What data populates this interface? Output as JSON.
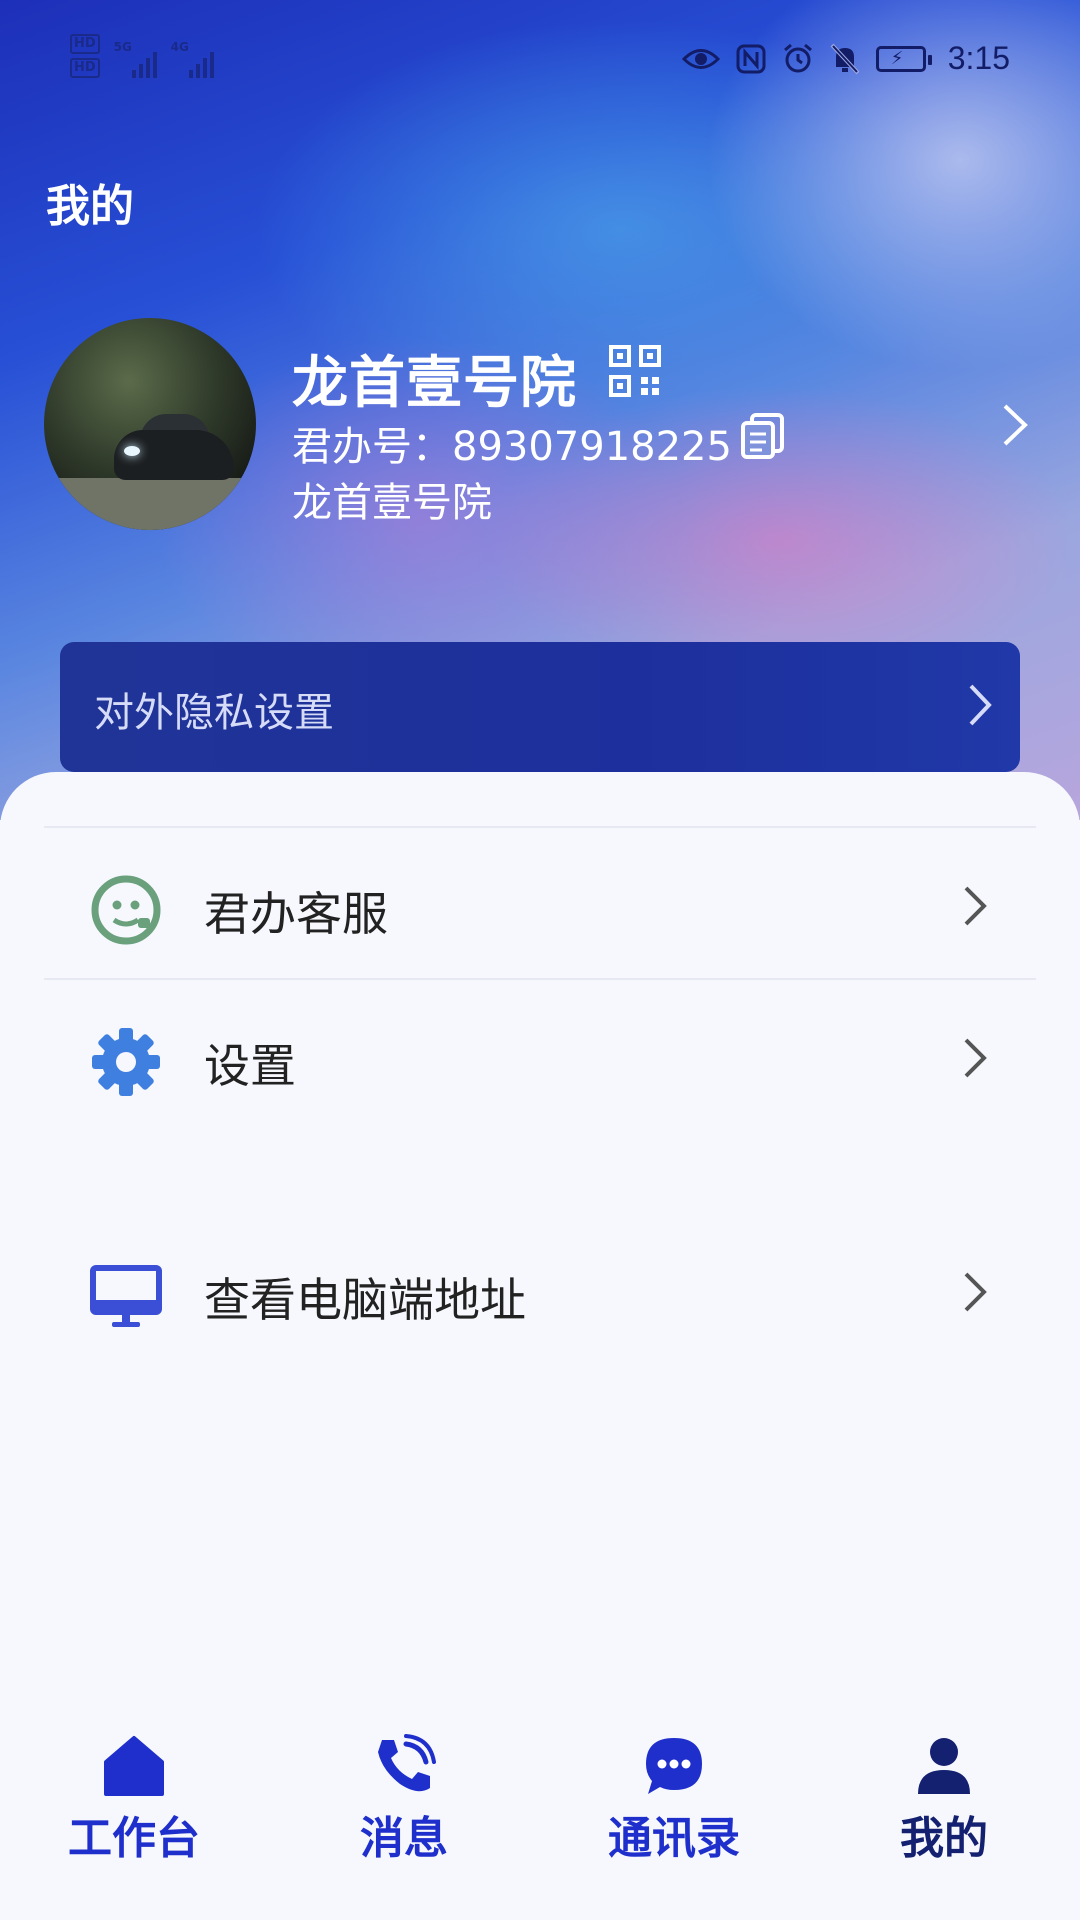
{
  "status_bar": {
    "left_badges": [
      "HD",
      "HD"
    ],
    "networks": [
      "5G",
      "4G"
    ],
    "time": "3:15",
    "icons": [
      "eye-icon",
      "nfc-icon",
      "alarm-icon",
      "bell-off-icon",
      "battery-charging-icon"
    ]
  },
  "page": {
    "title": "我的"
  },
  "profile": {
    "name": "龙首壹号院",
    "id_label": "君办号：",
    "id_value": "89307918225",
    "organization": "龙首壹号院"
  },
  "privacy": {
    "label": "对外隐私设置"
  },
  "menu": {
    "items": [
      {
        "label": "君办客服",
        "icon": "customer-service-icon"
      },
      {
        "label": "设置",
        "icon": "gear-icon"
      },
      {
        "label": "查看电脑端地址",
        "icon": "monitor-icon"
      }
    ]
  },
  "bottom_nav": {
    "items": [
      {
        "label": "工作台",
        "icon": "home-icon"
      },
      {
        "label": "消息",
        "icon": "phone-call-icon"
      },
      {
        "label": "通讯录",
        "icon": "chat-bubble-icon"
      },
      {
        "label": "我的",
        "icon": "person-icon",
        "active": true
      }
    ]
  },
  "colors": {
    "accent": "#1f2fcc",
    "active_nav": "#142070",
    "privacy_card": "#1d2f9c",
    "sheet_bg": "#f6f8fd",
    "service_icon": "#6aa07c",
    "gear_icon": "#3f7fe0",
    "monitor_icon": "#3a4fd6"
  }
}
